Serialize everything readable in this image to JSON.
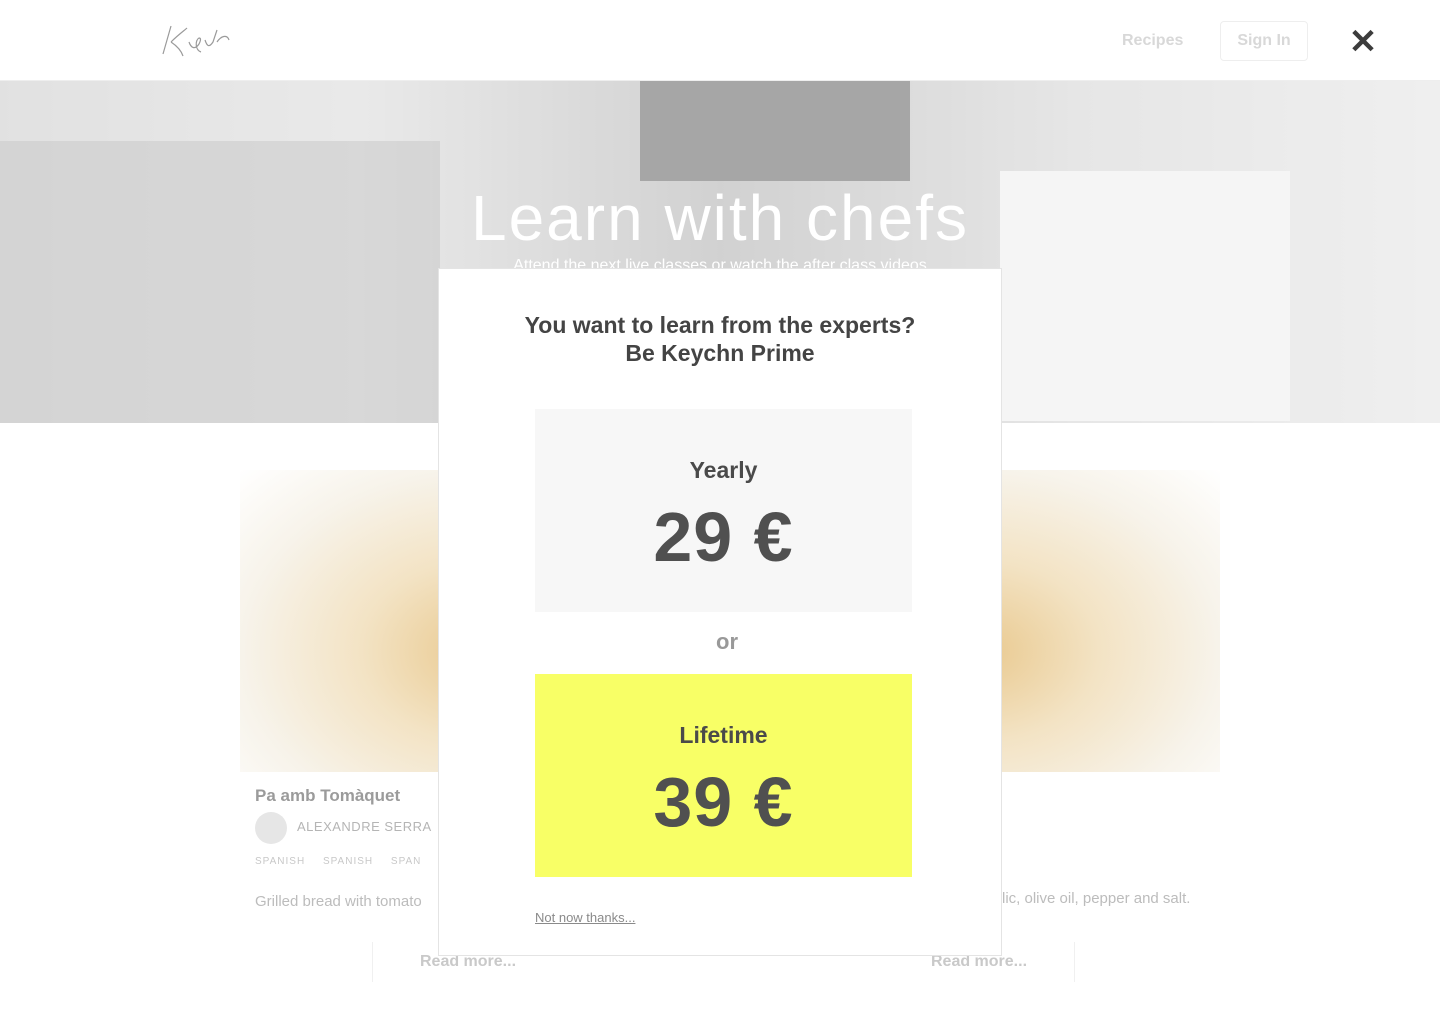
{
  "header": {
    "logo_text": "Keych",
    "nav_recipes": "Recipes",
    "nav_signin": "Sign In",
    "close_icon": "close-icon"
  },
  "hero": {
    "title": "Learn with chefs",
    "subtitle": "Attend the next live classes or watch the after class videos"
  },
  "cards": [
    {
      "title": "Pa amb Tomàquet",
      "author": "ALEXANDRE SERRA",
      "tags": [
        "SPANISH",
        "SPANISH",
        "SPAN"
      ],
      "description": "Grilled bread with tomato",
      "read_more": "Read more..."
    },
    {
      "description": "lic, olive oil, pepper and salt.",
      "read_more": "Read more..."
    }
  ],
  "modal": {
    "heading_line1": "You want to learn from the experts?",
    "heading_line2": "Be Keychn Prime",
    "plans": [
      {
        "name": "Yearly",
        "price": "29 €",
        "background": "#f7f7f7"
      },
      {
        "name": "Lifetime",
        "price": "39 €",
        "background": "#f8ff66"
      }
    ],
    "or_label": "or",
    "dismiss": "Not now thanks..."
  },
  "colors": {
    "accent_yellow": "#f8ff66",
    "text_dark": "#444444"
  }
}
